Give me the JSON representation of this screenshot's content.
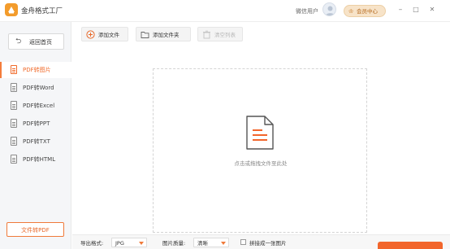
{
  "app": {
    "title": "金舟格式工厂"
  },
  "header": {
    "user_name": "微信用户",
    "vip_label": "会员中心"
  },
  "window_controls": {
    "min": "–",
    "max": "□",
    "close": "✕"
  },
  "sidebar": {
    "home_label": "返回首页",
    "items": [
      {
        "label": "PDF转图片",
        "active": true
      },
      {
        "label": "PDF转Word",
        "active": false
      },
      {
        "label": "PDF转Excel",
        "active": false
      },
      {
        "label": "PDF转PPT",
        "active": false
      },
      {
        "label": "PDF转TXT",
        "active": false
      },
      {
        "label": "PDF转HTML",
        "active": false
      }
    ],
    "cta_label": "文件转PDF"
  },
  "toolbar": {
    "add_file": "添加文件",
    "add_folder": "添加文件夹",
    "clear_list": "清空列表"
  },
  "dropzone": {
    "hint": "点击或拖拽文件至此处"
  },
  "bottom": {
    "format_label": "导出格式:",
    "format_value": "JPG",
    "quality_label": "图片质量:",
    "quality_value": "清晰",
    "merge_label": "拼接成一张图片"
  },
  "colors": {
    "accent": "#f2662c",
    "vip": "#f7e3c8",
    "sidebar_bg": "#f5f6f8"
  },
  "icons": [
    "app-logo-icon",
    "avatar-icon",
    "home-icon",
    "file-icon",
    "add-icon",
    "folder-icon",
    "clear-icon",
    "document-icon"
  ]
}
